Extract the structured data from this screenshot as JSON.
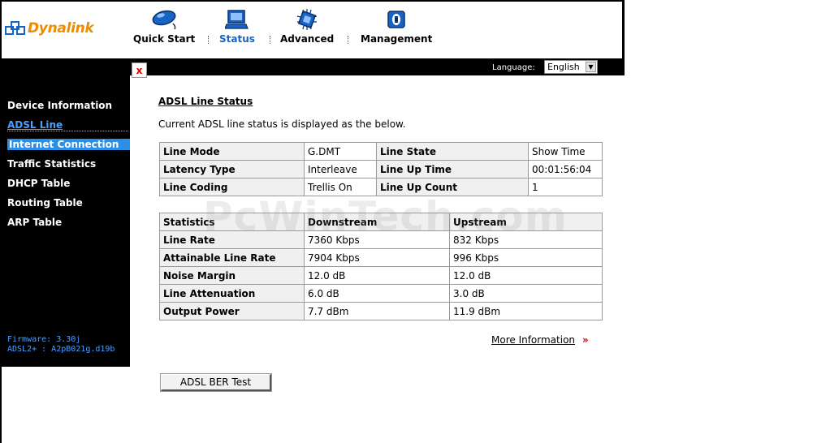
{
  "brand": {
    "name": "Dynalink",
    "color": "#f08a00"
  },
  "nav": {
    "items": [
      {
        "label": "Quick Start",
        "icon": "mouse-icon"
      },
      {
        "label": "Status",
        "icon": "monitor-icon",
        "active": true
      },
      {
        "label": "Advanced",
        "icon": "chip-icon"
      },
      {
        "label": "Management",
        "icon": "lock-icon"
      }
    ],
    "active_color": "#1764c4"
  },
  "language": {
    "label": "Language:",
    "selected": "English"
  },
  "sidebar": {
    "close_symbol": "x",
    "items": [
      {
        "label": "Device Information"
      },
      {
        "label": "ADSL Line",
        "current": true
      },
      {
        "label": "Internet Connection",
        "highlighted": true
      },
      {
        "label": "Traffic Statistics"
      },
      {
        "label": "DHCP Table"
      },
      {
        "label": "Routing Table"
      },
      {
        "label": "ARP Table"
      }
    ],
    "firmware": "Firmware: 3.30j",
    "adsl": "ADSL2+ : A2pB021g.d19b"
  },
  "main": {
    "title": "ADSL Line Status",
    "description": "Current ADSL line status is displayed as the below.",
    "status_table": [
      [
        "Line Mode",
        "G.DMT",
        "Line State",
        "Show Time"
      ],
      [
        "Latency Type",
        "Interleave",
        "Line Up Time",
        "00:01:56:04"
      ],
      [
        "Line Coding",
        "Trellis On",
        "Line Up Count",
        "1"
      ]
    ],
    "stats_headers": [
      "Statistics",
      "Downstream",
      "Upstream"
    ],
    "stats_table": [
      [
        "Line Rate",
        "7360 Kbps",
        "832 Kbps"
      ],
      [
        "Attainable Line Rate",
        "7904 Kbps",
        "996 Kbps"
      ],
      [
        "Noise Margin",
        "12.0 dB",
        "12.0 dB"
      ],
      [
        "Line Attenuation",
        "6.0 dB",
        "3.0 dB"
      ],
      [
        "Output Power",
        "7.7 dBm",
        "11.9 dBm"
      ]
    ],
    "more_info": "More Information",
    "more_arrow": "»",
    "ber_button": "ADSL BER Test"
  },
  "watermark": "PcWinTech.com"
}
